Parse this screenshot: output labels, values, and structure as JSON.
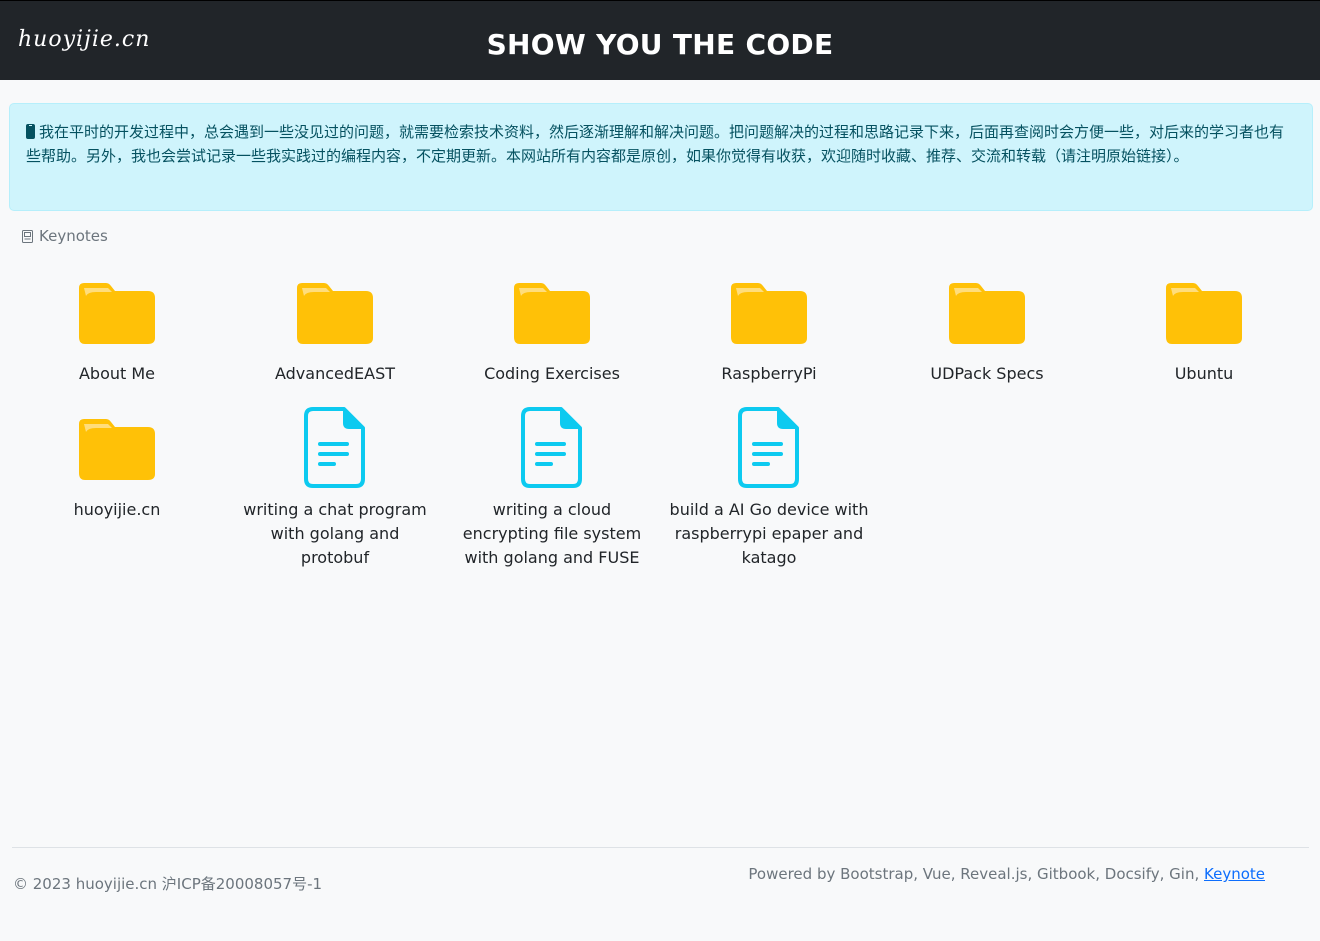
{
  "header": {
    "logo": "huoyijie.cn",
    "title": "SHOW YOU THE CODE"
  },
  "notice": {
    "icon": "mobile-phone-icon",
    "text": "我在平时的开发过程中，总会遇到一些没见过的问题，就需要检索技术资料，然后逐渐理解和解决问题。把问题解决的过程和思路记录下来，后面再查阅时会方便一些，对后来的学习者也有些帮助。另外，我也会尝试记录一些我实践过的编程内容，不定期更新。本网站所有内容都是原创，如果你觉得有收获，欢迎随时收藏、推荐、交流和转载（请注明原始链接）。"
  },
  "section": {
    "icon": "keynote-icon",
    "label": "Keynotes"
  },
  "items": [
    {
      "type": "folder",
      "label": "About Me"
    },
    {
      "type": "folder",
      "label": "AdvancedEAST"
    },
    {
      "type": "folder",
      "label": "Coding Exercises"
    },
    {
      "type": "folder",
      "label": "RaspberryPi"
    },
    {
      "type": "folder",
      "label": "UDPack Specs"
    },
    {
      "type": "folder",
      "label": "Ubuntu"
    },
    {
      "type": "folder",
      "label": "huoyijie.cn"
    },
    {
      "type": "document",
      "label": "writing a chat program with golang and protobuf"
    },
    {
      "type": "document",
      "label": "writing a cloud encrypting file system with golang and FUSE"
    },
    {
      "type": "document",
      "label": "build a AI Go device with raspberrypi epaper and katago"
    }
  ],
  "colors": {
    "header_bg": "#212529",
    "folder": "#ffc107",
    "document": "#0dcaf0",
    "notice_bg": "#cff4fc",
    "notice_text": "#055160",
    "link": "#0d6efd"
  },
  "footer": {
    "copyright": "© 2023 huoyijie.cn 沪ICP备20008057号-1",
    "powered_prefix": "Powered by Bootstrap, Vue, Reveal.js, Gitbook, Docsify, Gin, ",
    "powered_link": "Keynote"
  }
}
